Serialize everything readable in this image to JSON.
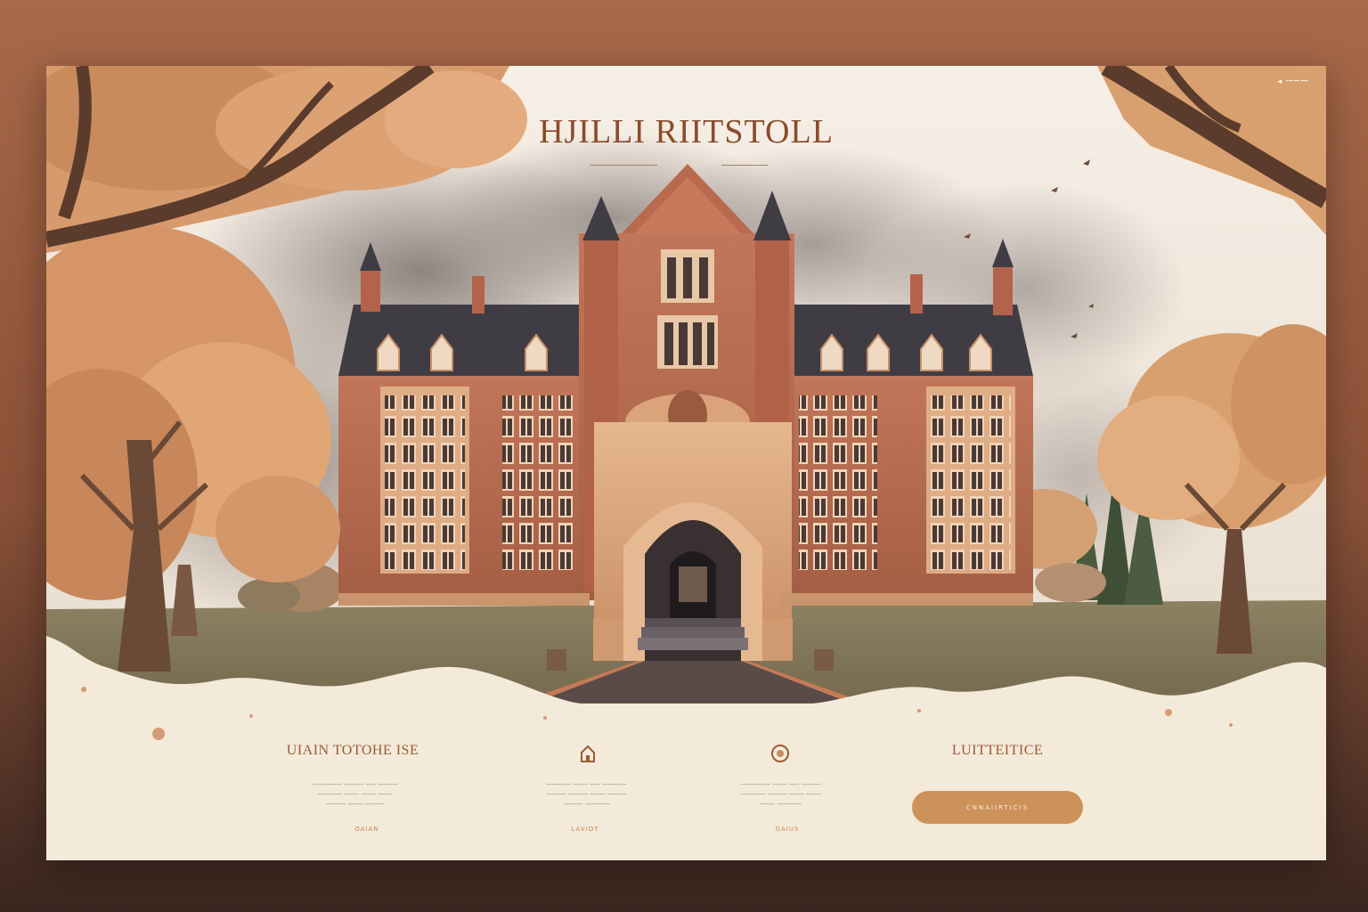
{
  "header": {
    "title": "HJILLI RIITSTOLL",
    "nav_text": "◂ ꟷꟷꟷ"
  },
  "features": [
    {
      "icon": "serif-text-heading",
      "title": "UIAIN TOTOHE ISE",
      "desc_lines": [
        "ꟷꟷꟷꟷꟷꟷ ꟷꟷꟷꟷ ꟷꟷ ꟷꟷꟷꟷ",
        "ꟷꟷꟷꟷꟷ ꟷꟷꟷ ꟷꟷꟷ ꟷꟷꟷ",
        "ꟷꟷꟷꟷ ꟷꟷꟷ ꟷꟷꟷꟷ"
      ],
      "link": "OAIAN"
    },
    {
      "icon": "house-icon",
      "title": "",
      "desc_lines": [
        "ꟷꟷꟷꟷꟷ ꟷꟷꟷ ꟷꟷ ꟷꟷꟷꟷꟷ",
        "ꟷꟷꟷꟷ ꟷꟷꟷꟷ ꟷꟷꟷ ꟷꟷꟷꟷ",
        "ꟷꟷꟷꟷ ꟷꟷꟷꟷꟷ"
      ],
      "link": "LAVIOT"
    },
    {
      "icon": "ring-icon",
      "title": "",
      "desc_lines": [
        "ꟷꟷꟷꟷꟷꟷ ꟷꟷꟷ ꟷꟷ ꟷꟷꟷꟷ",
        "ꟷꟷꟷꟷꟷ ꟷꟷꟷꟷ ꟷꟷꟷ ꟷꟷꟷ",
        "ꟷꟷꟷ ꟷꟷꟷꟷꟷ"
      ],
      "link": "GAIUS"
    },
    {
      "icon": "",
      "title": "LUITTEITICE",
      "desc_lines": [],
      "link": ""
    }
  ],
  "cta": {
    "label": "CNNAIIRTICIS"
  },
  "colors": {
    "brick": "#b96a4e",
    "roof": "#3f3c44",
    "foliage": "#d79a6c",
    "accent": "#cd925a",
    "cream": "#f4ead9"
  }
}
